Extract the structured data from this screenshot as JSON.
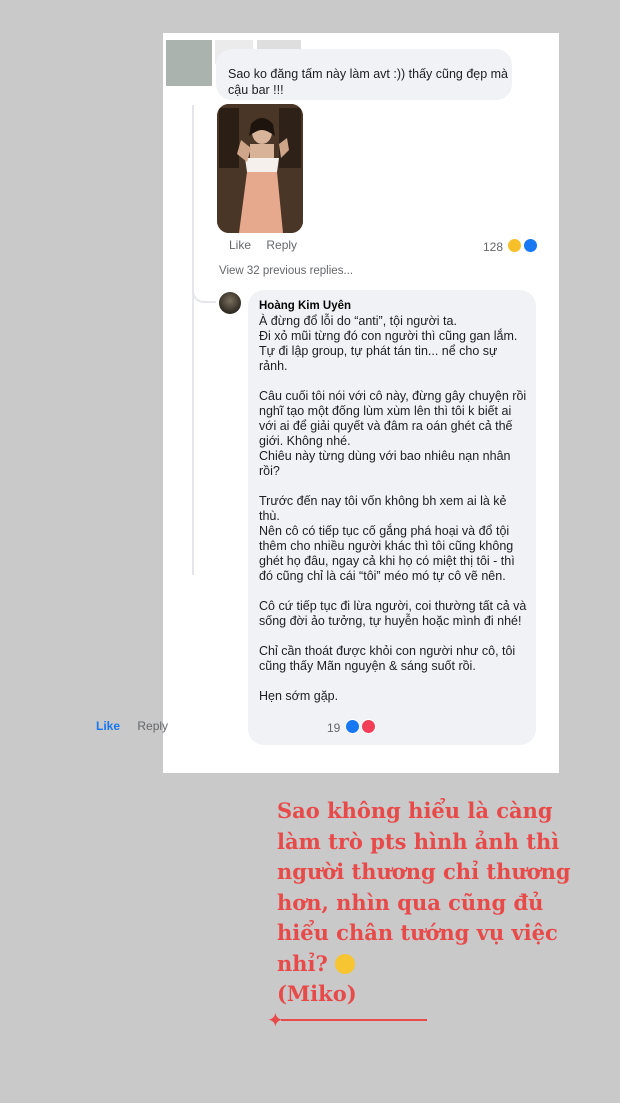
{
  "comment1": {
    "text": "Sao ko đăng tấm này làm avt :)) thấy cũng đẹp mà cậu bar !!!",
    "like": "Like",
    "reply": "Reply",
    "reaction_count": "128"
  },
  "view_previous": "View 32 previous replies...",
  "reply": {
    "author": "Hoàng Kim Uyên",
    "paragraphs": [
      "À đừng đổ lỗi do “anti”, tội người ta.\nĐi xỏ mũi từng đó con người thì cũng gan lắm.\nTự đi lập group, tự phát tán tin... nể cho sự rảnh.",
      "Câu cuối tôi nói với cô này, đừng gây chuyện rồi nghĩ tạo một đống lùm xùm lên thì tôi k biết ai với ai để giải quyết và đâm ra oán ghét cả thế giới. Không nhé.\nChiêu này từng dùng với bao nhiêu nạn nhân rồi?",
      "Trước đến nay tôi vốn không bh xem ai là kẻ thù.\nNên cô có tiếp tục cố gắng phá hoại và đổ tội thêm cho nhiều người khác thì tôi cũng không ghét họ đâu, ngay cả khi họ có miệt thị tôi - thì đó cũng chỉ là cái “tôi” méo mó tự cô vẽ nên.",
      "Cô cứ tiếp tục đi lừa người, coi thường tất cả và sống đời ảo tưởng, tự huyễn hoặc mình đi nhé!",
      "Chỉ cần thoát được khỏi con người như cô, tôi cũng thấy Mãn nguyện & sáng suốt rồi.",
      "Hẹn sớm gặp."
    ],
    "like": "Like",
    "reply": "Reply",
    "reaction_count": "19"
  },
  "caption": "Sao không hiểu là càng làm trò pts hình ảnh thì người thương chỉ thương hơn, nhìn qua cũng đủ hiểu chân tướng vụ việc nhỉ?",
  "caption_end": "(Miko)",
  "colors": {
    "caption": "#e84a4a",
    "like_blue": "#1877f2",
    "bubble": "#f0f2f5"
  }
}
